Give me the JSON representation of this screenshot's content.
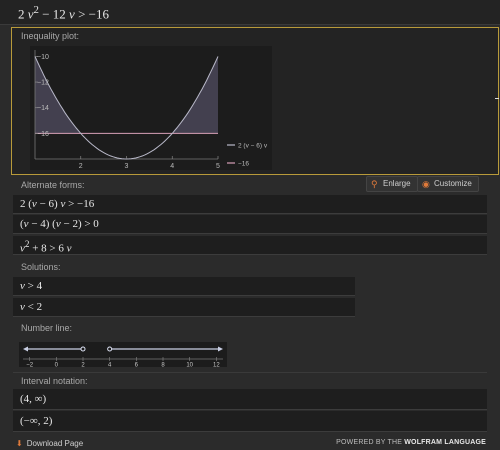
{
  "query": {
    "html": "2 <i>v</i><sup>2</sup> − 12 <i>v</i> &gt; −16"
  },
  "pods": {
    "inequality_plot": "Inequality plot:",
    "alternate_forms": "Alternate forms:",
    "solutions": "Solutions:",
    "number_line": "Number line:",
    "interval_notation": "Interval notation:"
  },
  "buttons": {
    "enlarge": "Enlarge",
    "customize": "Customize"
  },
  "alternate_forms": [
    {
      "html": "2 (<i>v</i> − 6) <i>v</i> &gt; −16"
    },
    {
      "html": "(<i>v</i> − 4) (<i>v</i> − 2) &gt; 0"
    },
    {
      "html": "<i>v</i><sup>2</sup> + 8 &gt; 6 <i>v</i>"
    }
  ],
  "solutions": [
    {
      "html": "<i>v</i> &gt; 4"
    },
    {
      "html": "<i>v</i> &lt; 2"
    }
  ],
  "intervals": [
    {
      "html": "(4, ∞)"
    },
    {
      "html": "(−∞, 2)"
    }
  ],
  "plot": {
    "y_ticks": [
      "−10",
      "−12",
      "−14",
      "−16"
    ],
    "x_ticks": [
      "2",
      "3",
      "4",
      "5"
    ],
    "legend": [
      "2 (v − 6) v",
      "−16"
    ],
    "colors": {
      "curve": "#b9b9c9",
      "line": "#d8a0b8",
      "fill": "#4a4658"
    }
  },
  "chart_data": {
    "type": "line",
    "x": [
      1,
      1.5,
      2,
      2.5,
      3,
      3.5,
      4,
      4.5,
      5
    ],
    "series": [
      {
        "name": "2 (v − 6) v",
        "values": [
          -10,
          -13.5,
          -16,
          -17.5,
          -18,
          -17.5,
          -16,
          -13.5,
          -10
        ]
      },
      {
        "name": "−16",
        "values": [
          -16,
          -16,
          -16,
          -16,
          -16,
          -16,
          -16,
          -16,
          -16
        ]
      }
    ],
    "xlim": [
      1,
      5
    ],
    "ylim": [
      -18,
      -9.5
    ],
    "shaded": "regions where 2(v−6)v > −16"
  },
  "number_line": {
    "ticks": [
      "−2",
      "0",
      "2",
      "4",
      "6",
      "8",
      "10",
      "12"
    ],
    "open_points": [
      2,
      4
    ]
  },
  "footer": {
    "download": "Download Page",
    "powered_prefix": "POWERED BY THE",
    "powered_brand": "WOLFRAM LANGUAGE"
  }
}
